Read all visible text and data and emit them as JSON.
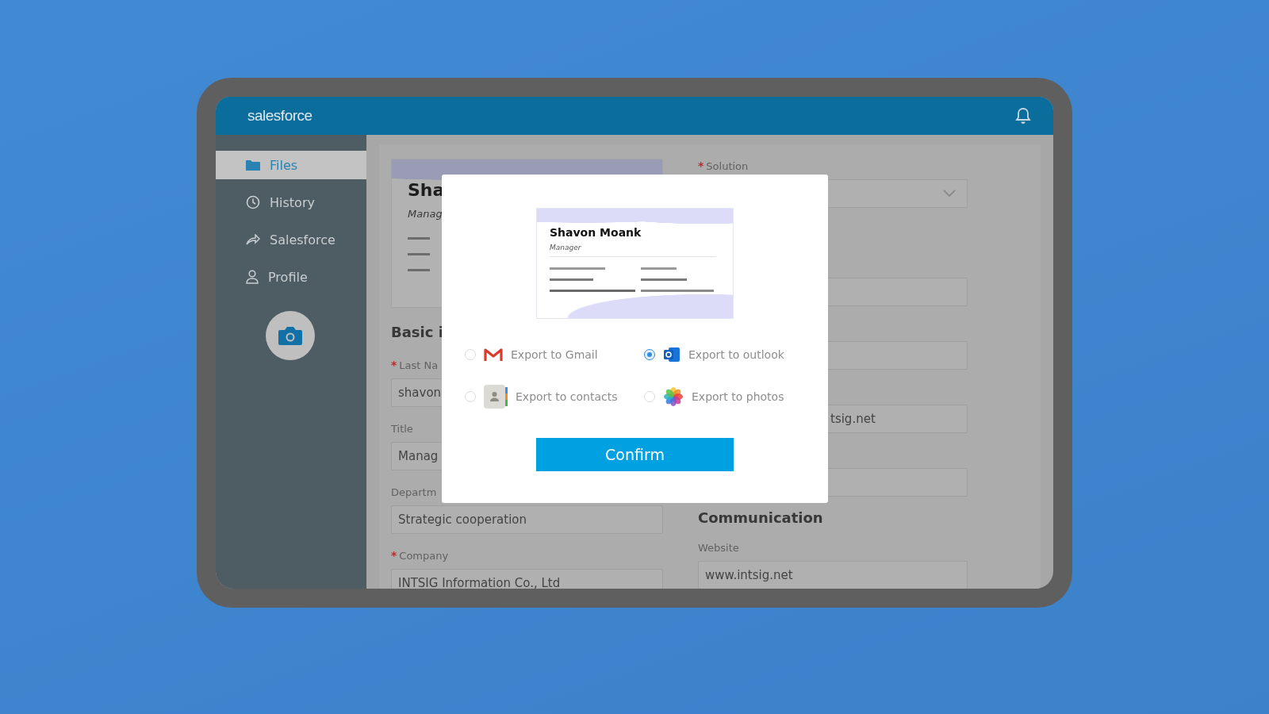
{
  "app": {
    "logo": "salesforce"
  },
  "sidebar": {
    "items": [
      {
        "label": "Files",
        "selected": true
      },
      {
        "label": "History",
        "selected": false
      },
      {
        "label": "Salesforce",
        "selected": false
      },
      {
        "label": "Profile",
        "selected": false
      }
    ]
  },
  "background_card": {
    "name": "Sha",
    "title": "Manag"
  },
  "form": {
    "left": [
      {
        "kind": "heading",
        "text": "Basic i"
      },
      {
        "kind": "field",
        "mark": "*",
        "label": "Last Na",
        "value": "shavon"
      },
      {
        "kind": "field",
        "label": "Title",
        "value": "Manag"
      },
      {
        "kind": "field",
        "label": "Departm",
        "value": "Strategic cooperation"
      },
      {
        "kind": "field",
        "mark": "*",
        "label": "Company",
        "value": "INTSIG Information Co., Ltd"
      }
    ],
    "right": [
      {
        "kind": "select",
        "mark": "*",
        "label": "Solution"
      },
      {
        "kind": "field"
      },
      {
        "kind": "field"
      },
      {
        "kind": "field",
        "value": "tsig.net",
        "cut": true
      },
      {
        "kind": "field"
      },
      {
        "kind": "heading",
        "text": "Communication"
      },
      {
        "kind": "field",
        "label": "Website",
        "value": "www.intsig.net"
      }
    ]
  },
  "dialog": {
    "card": {
      "name": "Shavon Moank",
      "title": "Manager"
    },
    "options": [
      {
        "label": "Export to Gmail",
        "kind": "gmail",
        "selected": false
      },
      {
        "label": "Export to outlook",
        "kind": "outlook",
        "selected": true
      },
      {
        "label": "Export to contacts",
        "kind": "contacts",
        "selected": false
      },
      {
        "label": "Export to photos",
        "kind": "photos",
        "selected": false
      }
    ],
    "confirm": "Confirm"
  }
}
